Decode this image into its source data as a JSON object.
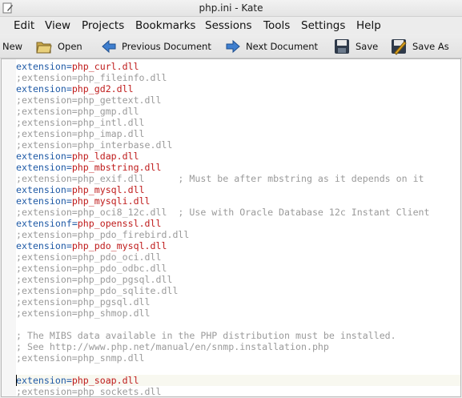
{
  "window": {
    "title": "php.ini - Kate"
  },
  "menubar": {
    "items": [
      "Edit",
      "View",
      "Projects",
      "Bookmarks",
      "Sessions",
      "Tools",
      "Settings",
      "Help"
    ]
  },
  "toolbar": {
    "new_label": "New",
    "open_label": "Open",
    "prev_label": "Previous Document",
    "next_label": "Next Document",
    "save_label": "Save",
    "saveas_label": "Save As"
  },
  "colors": {
    "key": "#1f5aa6",
    "value": "#bf1b1b",
    "comment": "#9a9a9a"
  },
  "editor": {
    "cursor_line": 29,
    "lines": [
      {
        "type": "setting",
        "key": "extension",
        "value": "php_curl.dll"
      },
      {
        "type": "comment",
        "text": ";extension=php_fileinfo.dll"
      },
      {
        "type": "setting",
        "key": "extension",
        "value": "php_gd2.dll"
      },
      {
        "type": "comment",
        "text": ";extension=php_gettext.dll"
      },
      {
        "type": "comment",
        "text": ";extension=php_gmp.dll"
      },
      {
        "type": "comment",
        "text": ";extension=php_intl.dll"
      },
      {
        "type": "comment",
        "text": ";extension=php_imap.dll"
      },
      {
        "type": "comment",
        "text": ";extension=php_interbase.dll"
      },
      {
        "type": "setting",
        "key": "extension",
        "value": "php_ldap.dll"
      },
      {
        "type": "setting",
        "key": "extension",
        "value": "php_mbstring.dll"
      },
      {
        "type": "comment",
        "text": ";extension=php_exif.dll      ; Must be after mbstring as it depends on it"
      },
      {
        "type": "setting",
        "key": "extension",
        "value": "php_mysql.dll"
      },
      {
        "type": "setting",
        "key": "extension",
        "value": "php_mysqli.dll"
      },
      {
        "type": "comment",
        "text": ";extension=php_oci8_12c.dll  ; Use with Oracle Database 12c Instant Client"
      },
      {
        "type": "setting",
        "key": "extensionf",
        "value": "php_openssl.dll"
      },
      {
        "type": "comment",
        "text": ";extension=php_pdo_firebird.dll"
      },
      {
        "type": "setting",
        "key": "extension",
        "value": "php_pdo_mysql.dll"
      },
      {
        "type": "comment",
        "text": ";extension=php_pdo_oci.dll"
      },
      {
        "type": "comment",
        "text": ";extension=php_pdo_odbc.dll"
      },
      {
        "type": "comment",
        "text": ";extension=php_pdo_pgsql.dll"
      },
      {
        "type": "comment",
        "text": ";extension=php_pdo_sqlite.dll"
      },
      {
        "type": "comment",
        "text": ";extension=php_pgsql.dll"
      },
      {
        "type": "comment",
        "text": ";extension=php_shmop.dll"
      },
      {
        "type": "blank",
        "text": ""
      },
      {
        "type": "comment",
        "text": "; The MIBS data available in the PHP distribution must be installed."
      },
      {
        "type": "comment",
        "text": "; See http://www.php.net/manual/en/snmp.installation.php"
      },
      {
        "type": "comment",
        "text": ";extension=php_snmp.dll"
      },
      {
        "type": "blank",
        "text": ""
      },
      {
        "type": "setting",
        "key": "extension",
        "value": "php_soap.dll"
      },
      {
        "type": "comment",
        "text": ";extension=php_sockets.dll"
      }
    ]
  }
}
